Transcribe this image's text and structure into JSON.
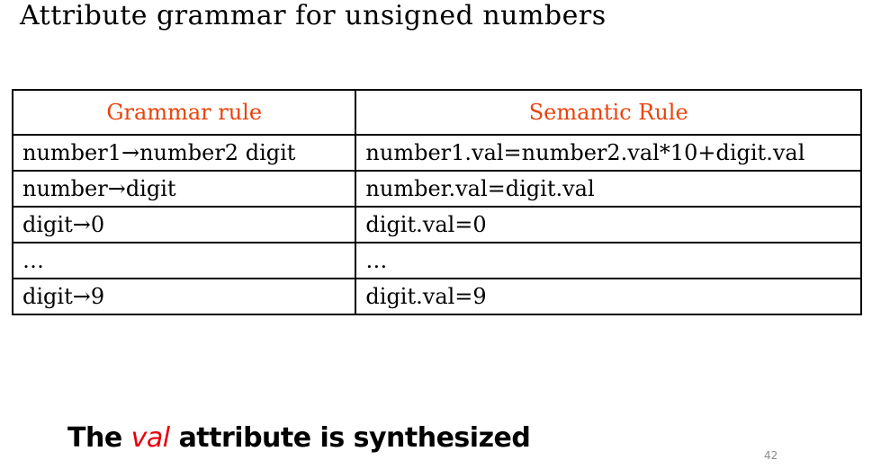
{
  "title": "Attribute grammar for unsigned numbers",
  "table": {
    "headers": [
      "Grammar rule",
      "Semantic Rule"
    ],
    "rows": [
      [
        "number1→number2 digit",
        "number1.val=number2.val*10+digit.val"
      ],
      [
        "number→digit",
        "number.val=digit.val"
      ],
      [
        "digit→0",
        "digit.val=0"
      ],
      [
        "…",
        "…"
      ],
      [
        "digit→9",
        "digit.val=9"
      ]
    ]
  },
  "footer": {
    "prefix": "The",
    "highlight": "val",
    "suffix": "attribute is synthesized"
  },
  "page_number": "42",
  "colors": {
    "header_text": "#e8430c",
    "highlight": "#e8000b"
  }
}
